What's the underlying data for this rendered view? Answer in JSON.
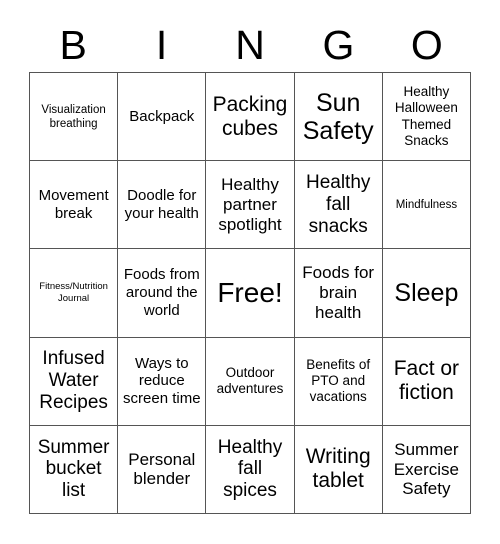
{
  "card": {
    "header_letters": [
      "B",
      "I",
      "N",
      "G",
      "O"
    ],
    "free_space_label": "Free!",
    "colors": {
      "background": "#ffffff",
      "text": "#000000",
      "grid_line": "#555555"
    },
    "rows": [
      [
        {
          "text": "Visualization breathing",
          "size": "fs-11"
        },
        {
          "text": "Backpack",
          "size": "fs-15"
        },
        {
          "text": "Packing cubes",
          "size": "fs-21"
        },
        {
          "text": "Sun Safety",
          "size": "fs-25"
        },
        {
          "text": "Healthy Halloween Themed Snacks",
          "size": "fs-13"
        }
      ],
      [
        {
          "text": "Movement break",
          "size": "fs-15"
        },
        {
          "text": "Doodle for your health",
          "size": "fs-15"
        },
        {
          "text": "Healthy partner spotlight",
          "size": "fs-17"
        },
        {
          "text": "Healthy fall snacks",
          "size": "fs-19"
        },
        {
          "text": "Mindfulness",
          "size": "fs-11"
        }
      ],
      [
        {
          "text": "Fitness/Nutrition Journal",
          "size": "fs-9"
        },
        {
          "text": "Foods from around the world",
          "size": "fs-15"
        },
        {
          "text": "Free!",
          "size": "fs-28"
        },
        {
          "text": "Foods for brain health",
          "size": "fs-17"
        },
        {
          "text": "Sleep",
          "size": "fs-25"
        }
      ],
      [
        {
          "text": "Infused Water Recipes",
          "size": "fs-19"
        },
        {
          "text": "Ways to reduce screen time",
          "size": "fs-15"
        },
        {
          "text": "Outdoor adventures",
          "size": "fs-13"
        },
        {
          "text": "Benefits of PTO and vacations",
          "size": "fs-13"
        },
        {
          "text": "Fact or fiction",
          "size": "fs-21"
        }
      ],
      [
        {
          "text": "Summer bucket list",
          "size": "fs-19"
        },
        {
          "text": "Personal blender",
          "size": "fs-17"
        },
        {
          "text": "Healthy fall spices",
          "size": "fs-19"
        },
        {
          "text": "Writing tablet",
          "size": "fs-21"
        },
        {
          "text": "Summer Exercise Safety",
          "size": "fs-17"
        }
      ]
    ]
  }
}
